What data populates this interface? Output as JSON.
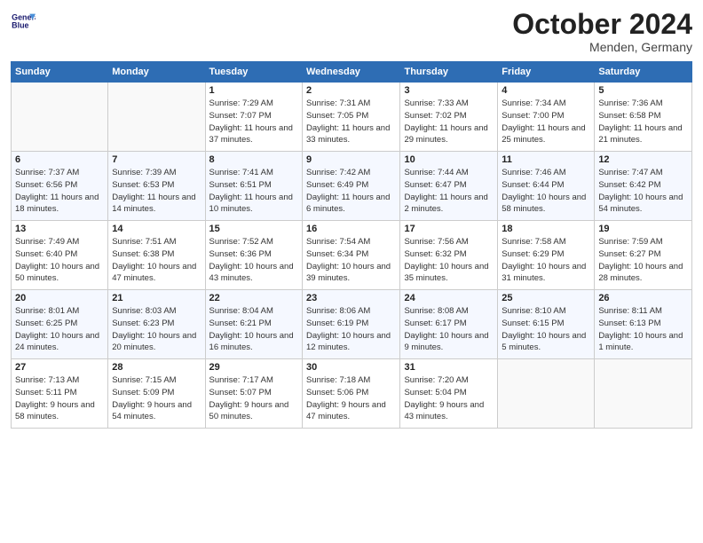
{
  "header": {
    "title": "October 2024",
    "location": "Menden, Germany",
    "logo_line1": "General",
    "logo_line2": "Blue"
  },
  "weekdays": [
    "Sunday",
    "Monday",
    "Tuesday",
    "Wednesday",
    "Thursday",
    "Friday",
    "Saturday"
  ],
  "weeks": [
    [
      {
        "day": "",
        "sunrise": "",
        "sunset": "",
        "daylight": ""
      },
      {
        "day": "",
        "sunrise": "",
        "sunset": "",
        "daylight": ""
      },
      {
        "day": "1",
        "sunrise": "Sunrise: 7:29 AM",
        "sunset": "Sunset: 7:07 PM",
        "daylight": "Daylight: 11 hours and 37 minutes."
      },
      {
        "day": "2",
        "sunrise": "Sunrise: 7:31 AM",
        "sunset": "Sunset: 7:05 PM",
        "daylight": "Daylight: 11 hours and 33 minutes."
      },
      {
        "day": "3",
        "sunrise": "Sunrise: 7:33 AM",
        "sunset": "Sunset: 7:02 PM",
        "daylight": "Daylight: 11 hours and 29 minutes."
      },
      {
        "day": "4",
        "sunrise": "Sunrise: 7:34 AM",
        "sunset": "Sunset: 7:00 PM",
        "daylight": "Daylight: 11 hours and 25 minutes."
      },
      {
        "day": "5",
        "sunrise": "Sunrise: 7:36 AM",
        "sunset": "Sunset: 6:58 PM",
        "daylight": "Daylight: 11 hours and 21 minutes."
      }
    ],
    [
      {
        "day": "6",
        "sunrise": "Sunrise: 7:37 AM",
        "sunset": "Sunset: 6:56 PM",
        "daylight": "Daylight: 11 hours and 18 minutes."
      },
      {
        "day": "7",
        "sunrise": "Sunrise: 7:39 AM",
        "sunset": "Sunset: 6:53 PM",
        "daylight": "Daylight: 11 hours and 14 minutes."
      },
      {
        "day": "8",
        "sunrise": "Sunrise: 7:41 AM",
        "sunset": "Sunset: 6:51 PM",
        "daylight": "Daylight: 11 hours and 10 minutes."
      },
      {
        "day": "9",
        "sunrise": "Sunrise: 7:42 AM",
        "sunset": "Sunset: 6:49 PM",
        "daylight": "Daylight: 11 hours and 6 minutes."
      },
      {
        "day": "10",
        "sunrise": "Sunrise: 7:44 AM",
        "sunset": "Sunset: 6:47 PM",
        "daylight": "Daylight: 11 hours and 2 minutes."
      },
      {
        "day": "11",
        "sunrise": "Sunrise: 7:46 AM",
        "sunset": "Sunset: 6:44 PM",
        "daylight": "Daylight: 10 hours and 58 minutes."
      },
      {
        "day": "12",
        "sunrise": "Sunrise: 7:47 AM",
        "sunset": "Sunset: 6:42 PM",
        "daylight": "Daylight: 10 hours and 54 minutes."
      }
    ],
    [
      {
        "day": "13",
        "sunrise": "Sunrise: 7:49 AM",
        "sunset": "Sunset: 6:40 PM",
        "daylight": "Daylight: 10 hours and 50 minutes."
      },
      {
        "day": "14",
        "sunrise": "Sunrise: 7:51 AM",
        "sunset": "Sunset: 6:38 PM",
        "daylight": "Daylight: 10 hours and 47 minutes."
      },
      {
        "day": "15",
        "sunrise": "Sunrise: 7:52 AM",
        "sunset": "Sunset: 6:36 PM",
        "daylight": "Daylight: 10 hours and 43 minutes."
      },
      {
        "day": "16",
        "sunrise": "Sunrise: 7:54 AM",
        "sunset": "Sunset: 6:34 PM",
        "daylight": "Daylight: 10 hours and 39 minutes."
      },
      {
        "day": "17",
        "sunrise": "Sunrise: 7:56 AM",
        "sunset": "Sunset: 6:32 PM",
        "daylight": "Daylight: 10 hours and 35 minutes."
      },
      {
        "day": "18",
        "sunrise": "Sunrise: 7:58 AM",
        "sunset": "Sunset: 6:29 PM",
        "daylight": "Daylight: 10 hours and 31 minutes."
      },
      {
        "day": "19",
        "sunrise": "Sunrise: 7:59 AM",
        "sunset": "Sunset: 6:27 PM",
        "daylight": "Daylight: 10 hours and 28 minutes."
      }
    ],
    [
      {
        "day": "20",
        "sunrise": "Sunrise: 8:01 AM",
        "sunset": "Sunset: 6:25 PM",
        "daylight": "Daylight: 10 hours and 24 minutes."
      },
      {
        "day": "21",
        "sunrise": "Sunrise: 8:03 AM",
        "sunset": "Sunset: 6:23 PM",
        "daylight": "Daylight: 10 hours and 20 minutes."
      },
      {
        "day": "22",
        "sunrise": "Sunrise: 8:04 AM",
        "sunset": "Sunset: 6:21 PM",
        "daylight": "Daylight: 10 hours and 16 minutes."
      },
      {
        "day": "23",
        "sunrise": "Sunrise: 8:06 AM",
        "sunset": "Sunset: 6:19 PM",
        "daylight": "Daylight: 10 hours and 12 minutes."
      },
      {
        "day": "24",
        "sunrise": "Sunrise: 8:08 AM",
        "sunset": "Sunset: 6:17 PM",
        "daylight": "Daylight: 10 hours and 9 minutes."
      },
      {
        "day": "25",
        "sunrise": "Sunrise: 8:10 AM",
        "sunset": "Sunset: 6:15 PM",
        "daylight": "Daylight: 10 hours and 5 minutes."
      },
      {
        "day": "26",
        "sunrise": "Sunrise: 8:11 AM",
        "sunset": "Sunset: 6:13 PM",
        "daylight": "Daylight: 10 hours and 1 minute."
      }
    ],
    [
      {
        "day": "27",
        "sunrise": "Sunrise: 7:13 AM",
        "sunset": "Sunset: 5:11 PM",
        "daylight": "Daylight: 9 hours and 58 minutes."
      },
      {
        "day": "28",
        "sunrise": "Sunrise: 7:15 AM",
        "sunset": "Sunset: 5:09 PM",
        "daylight": "Daylight: 9 hours and 54 minutes."
      },
      {
        "day": "29",
        "sunrise": "Sunrise: 7:17 AM",
        "sunset": "Sunset: 5:07 PM",
        "daylight": "Daylight: 9 hours and 50 minutes."
      },
      {
        "day": "30",
        "sunrise": "Sunrise: 7:18 AM",
        "sunset": "Sunset: 5:06 PM",
        "daylight": "Daylight: 9 hours and 47 minutes."
      },
      {
        "day": "31",
        "sunrise": "Sunrise: 7:20 AM",
        "sunset": "Sunset: 5:04 PM",
        "daylight": "Daylight: 9 hours and 43 minutes."
      },
      {
        "day": "",
        "sunrise": "",
        "sunset": "",
        "daylight": ""
      },
      {
        "day": "",
        "sunrise": "",
        "sunset": "",
        "daylight": ""
      }
    ]
  ]
}
